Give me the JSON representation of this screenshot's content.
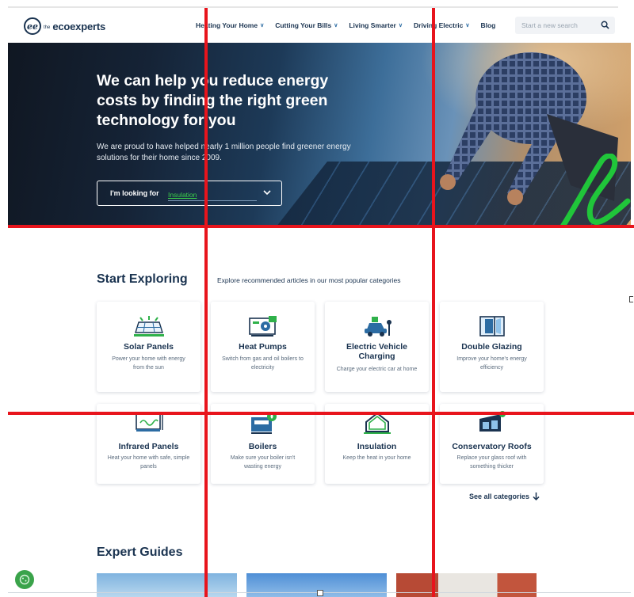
{
  "header": {
    "logo_the": "the",
    "logo_text": "ecoexperts",
    "nav": [
      {
        "label": "Heating Your Home"
      },
      {
        "label": "Cutting Your Bills"
      },
      {
        "label": "Living Smarter"
      },
      {
        "label": "Driving Electric"
      },
      {
        "label": "Blog"
      }
    ],
    "search_placeholder": "Start a new search"
  },
  "hero": {
    "title": "We can help you reduce energy costs by finding the right green technology for you",
    "subtitle": "We are proud to have helped nearly 1 million people find greener energy solutions for their home since 2009.",
    "looking_label": "I'm looking for",
    "looking_value": "Insulation"
  },
  "explore": {
    "title": "Start Exploring",
    "subtitle": "Explore recommended articles in our most popular categories",
    "cards": [
      {
        "title": "Solar Panels",
        "desc": "Power your home with energy from the sun",
        "icon": "solar-panel-icon"
      },
      {
        "title": "Heat Pumps",
        "desc": "Switch from gas and oil boilers to electricity",
        "icon": "heat-pump-icon"
      },
      {
        "title": "Electric Vehicle Charging",
        "desc": "Charge your electric car at home",
        "icon": "ev-charger-icon"
      },
      {
        "title": "Double Glazing",
        "desc": "Improve your home's energy efficiency",
        "icon": "window-icon"
      },
      {
        "title": "Infrared Panels",
        "desc": "Heat your home with safe, simple panels",
        "icon": "infrared-panel-icon"
      },
      {
        "title": "Boilers",
        "desc": "Make sure your boiler isn't wasting energy",
        "icon": "boiler-icon"
      },
      {
        "title": "Insulation",
        "desc": "Keep the heat in your home",
        "icon": "house-icon"
      },
      {
        "title": "Conservatory Roofs",
        "desc": "Replace your glass roof with something thicker",
        "icon": "conservatory-icon"
      }
    ],
    "see_all": "See all categories"
  },
  "guides": {
    "title": "Expert Guides"
  },
  "colors": {
    "navy": "#1a3350",
    "accent_green": "#3bd24a",
    "overlay_red": "#e8141c"
  }
}
